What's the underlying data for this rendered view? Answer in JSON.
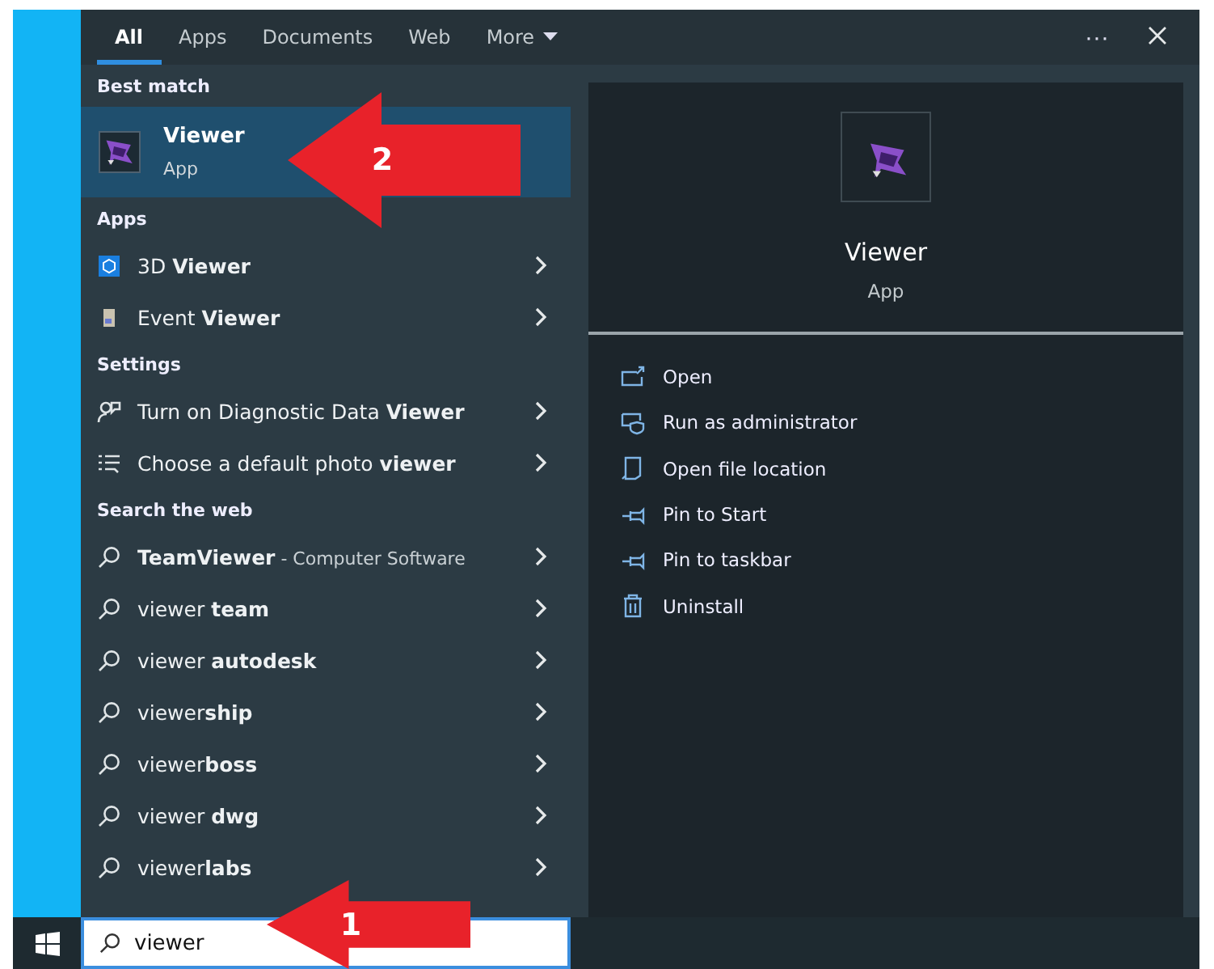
{
  "tabs": [
    {
      "label": "All",
      "selected": true
    },
    {
      "label": "Apps",
      "selected": false
    },
    {
      "label": "Documents",
      "selected": false
    },
    {
      "label": "Web",
      "selected": false
    },
    {
      "label": "More",
      "selected": false,
      "kind": "dropdown"
    }
  ],
  "window_controls": {
    "more": "···"
  },
  "best_match": {
    "header": "Best match",
    "title": "Viewer",
    "subtitle": "App",
    "selected": true,
    "annotation": "2"
  },
  "sections": [
    {
      "header": "Apps",
      "items": [
        {
          "kind": "cube",
          "text": "3D **Viewer**"
        },
        {
          "kind": "event",
          "text": "Event **Viewer**"
        }
      ]
    },
    {
      "header": "Settings",
      "items": [
        {
          "kind": "person",
          "text": "Turn on Diagnostic Data **Viewer**"
        },
        {
          "kind": "list",
          "text": "Choose a default photo **viewer**"
        }
      ]
    },
    {
      "header": "Search the web",
      "items": [
        {
          "kind": "search",
          "text": "**TeamViewer**",
          "note": "- Computer Software"
        },
        {
          "kind": "search",
          "text": "viewer **team**"
        },
        {
          "kind": "search",
          "text": "viewer **autodesk**"
        },
        {
          "kind": "search",
          "text": "viewer**ship**"
        },
        {
          "kind": "search",
          "text": "viewer**boss**"
        },
        {
          "kind": "search",
          "text": "viewer **dwg**"
        },
        {
          "kind": "search",
          "text": "viewer**labs**"
        }
      ]
    }
  ],
  "detail": {
    "title": "Viewer",
    "subtitle": "App",
    "actions": [
      {
        "kind": "open",
        "label": "Open"
      },
      {
        "kind": "admin",
        "label": "Run as administrator"
      },
      {
        "kind": "folder",
        "label": "Open file location"
      },
      {
        "kind": "pin",
        "label": "Pin to Start"
      },
      {
        "kind": "pin",
        "label": "Pin to taskbar"
      },
      {
        "kind": "trash",
        "label": "Uninstall"
      }
    ]
  },
  "taskbar": {
    "search": {
      "value": "viewer",
      "annotation": "1"
    }
  }
}
